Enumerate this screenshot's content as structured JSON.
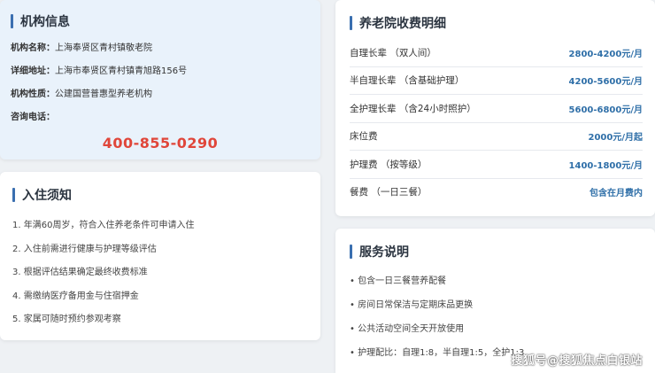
{
  "institution": {
    "title": "机构信息",
    "rows": [
      {
        "key": "机构名称：",
        "value": "上海奉贤区青村镇敬老院"
      },
      {
        "key": "详细地址：",
        "value": "上海市奉贤区青村镇青旭路156号"
      },
      {
        "key": "机构性质：",
        "value": "公建国营普惠型养老机构"
      },
      {
        "key": "咨询电话：",
        "value": ""
      }
    ],
    "phone": "400-855-0290"
  },
  "notice": {
    "title": "入住须知",
    "items": [
      "1. 年满60周岁，符合入住养老条件可申请入住",
      "2. 入住前需进行健康与护理等级评估",
      "3. 根据评估结果确定最终收费标准",
      "4. 需缴纳医疗备用金与住宿押金",
      "5. 家属可随时预约参观考察"
    ]
  },
  "fees": {
    "title": "养老院收费明细",
    "items": [
      {
        "name": "自理长辈 （双人间）",
        "price": "2800-4200元/月"
      },
      {
        "name": "半自理长辈 （含基础护理）",
        "price": "4200-5600元/月"
      },
      {
        "name": "全护理长辈 （含24小时照护）",
        "price": "5600-6800元/月"
      },
      {
        "name": "床位费",
        "price": "2000元/月起"
      },
      {
        "name": "护理费 （按等级）",
        "price": "1400-1800元/月"
      },
      {
        "name": "餐费 （一日三餐）",
        "price": "包含在月费内"
      }
    ]
  },
  "service": {
    "title": "服务说明",
    "items": [
      "• 包含一日三餐营养配餐",
      "• 房间日常保洁与定期床品更换",
      "• 公共活动空间全天开放使用",
      "• 护理配比：自理1:8，半自理1:5，全护1:3"
    ]
  },
  "watermark": "搜狐号@搜狐焦点白银站",
  "colors": {
    "accent": "#3a6fb0",
    "phone": "#e0463a",
    "price": "#2f6fa8",
    "info_bg": "#e9f2fb",
    "page_bg": "#eef1f4"
  }
}
